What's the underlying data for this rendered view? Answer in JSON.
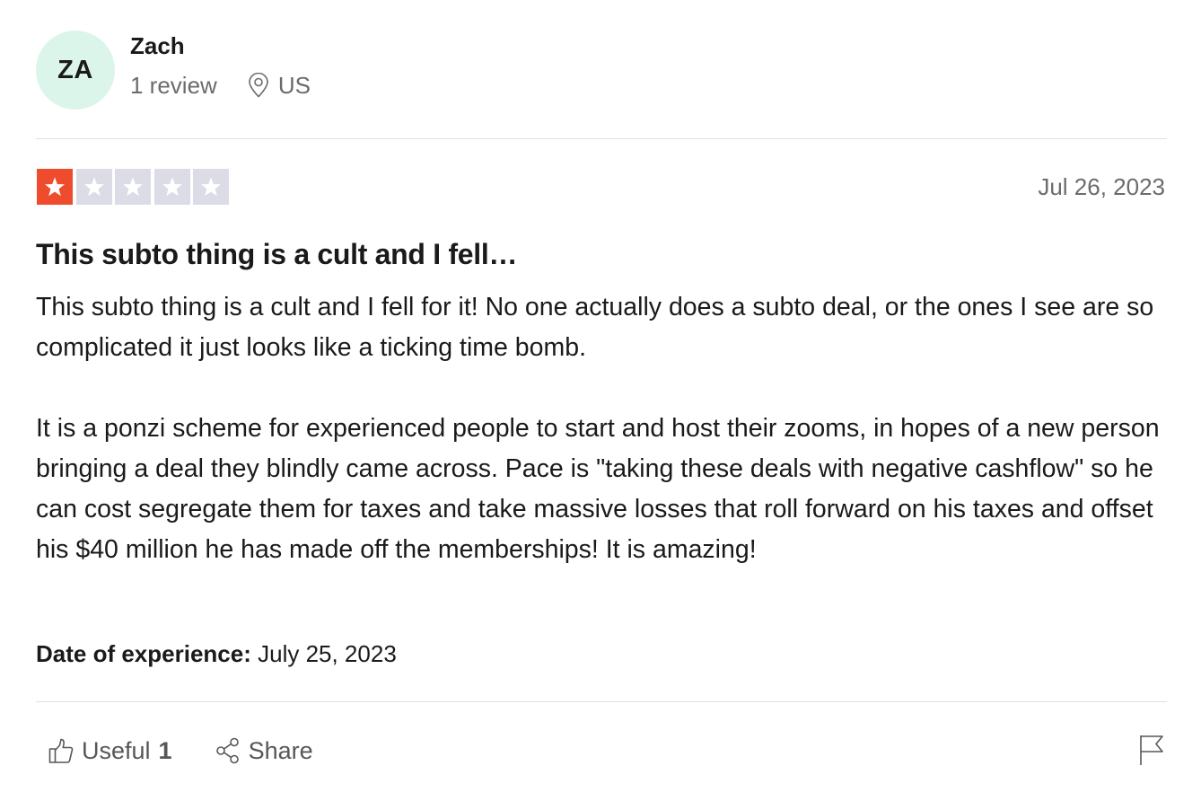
{
  "consumer": {
    "initials": "ZA",
    "name": "Zach",
    "review_count": "1 review",
    "location": "US",
    "avatar_color": "#dcf5ea"
  },
  "review": {
    "rating": 1,
    "rating_max": 5,
    "star_filled_color": "#ee4c2c",
    "star_empty_color": "#dcdce6",
    "date": "Jul 26, 2023",
    "title": "This subto thing is a cult and I fell…",
    "paragraphs": [
      "This subto thing is a cult and I fell for it! No one actually does a subto deal, or the ones I see are so complicated it just looks like a ticking time bomb.",
      "It is a ponzi scheme for experienced people to start and host their zooms, in hopes of a new person bringing a deal they blindly came across. Pace is \"taking these deals with negative cashflow\" so he can cost segregate them for taxes and take massive losses that roll forward on his taxes and offset his $40 million he has made off the memberships! It is amazing!"
    ],
    "experience_label": "Date of experience:",
    "experience_date": "July 25, 2023"
  },
  "actions": {
    "useful_label": "Useful",
    "useful_count": "1",
    "share_label": "Share",
    "icons": {
      "useful": "thumbs-up-icon",
      "share": "share-icon",
      "flag": "flag-icon",
      "location": "location-pin-icon",
      "star": "star-icon"
    }
  }
}
